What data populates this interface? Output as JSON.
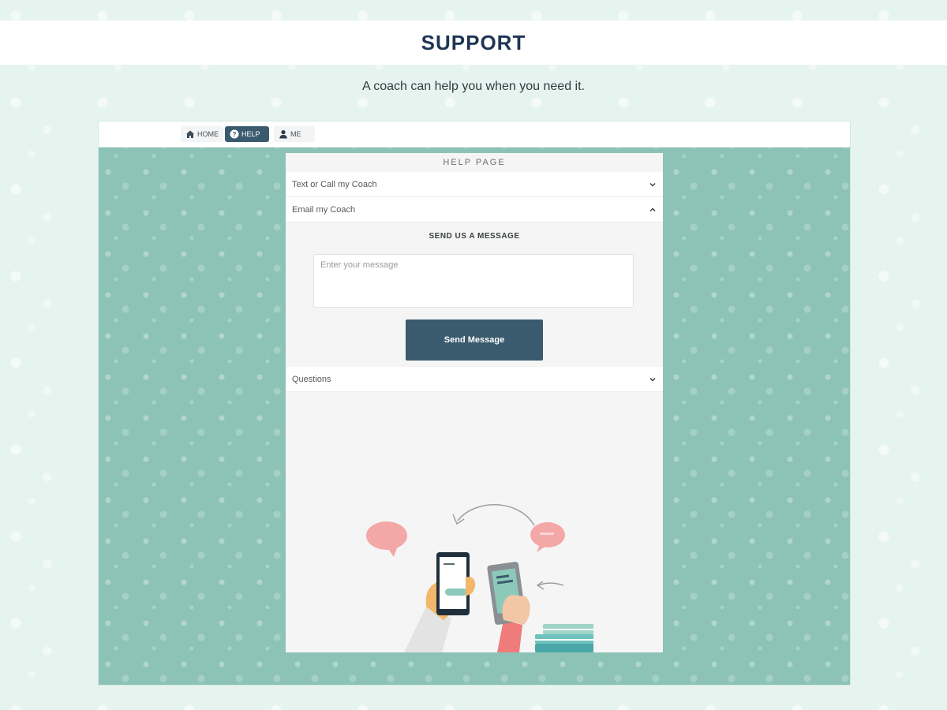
{
  "header": {
    "title": "SUPPORT"
  },
  "subtitle": "A coach can help you when you need it.",
  "nav": {
    "items": [
      {
        "label": "HOME",
        "icon": "home-icon",
        "active": false
      },
      {
        "label": "HELP",
        "icon": "help-circle-icon",
        "active": true
      },
      {
        "label": "ME",
        "icon": "user-icon",
        "active": false
      }
    ]
  },
  "help_page": {
    "title": "HELP PAGE",
    "sections": [
      {
        "label": "Text or Call my Coach",
        "expanded": false
      },
      {
        "label": "Email my Coach",
        "expanded": true
      },
      {
        "label": "Questions",
        "expanded": false
      }
    ],
    "email": {
      "heading": "SEND US A MESSAGE",
      "message_placeholder": "Enter your message",
      "message_value": "",
      "send_label": "Send Message"
    }
  },
  "colors": {
    "brand_dark": "#3a5a6e",
    "title_navy": "#1f3554",
    "pattern_teal": "#8cc3b6",
    "page_mint": "#e6f4f0",
    "bubble_pink": "#f4a7a7"
  }
}
